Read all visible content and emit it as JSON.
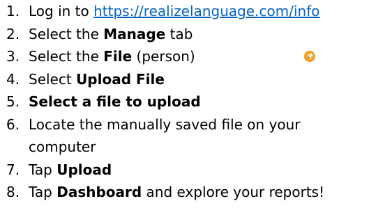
{
  "steps": [
    {
      "number": "1.",
      "prefix": "Log in to ",
      "link": "https://realizelanguage.com/info"
    },
    {
      "number": "2.",
      "prefix": "Select the ",
      "bold": "Manage",
      "suffix": " tab"
    },
    {
      "number": "3.",
      "prefix": "Select the ",
      "bold": "File",
      "suffix": " (person)",
      "icon": "orange-edit-icon"
    },
    {
      "number": "4.",
      "prefix": "Select ",
      "bold": "Upload File"
    },
    {
      "number": "5.",
      "bold": "Select a file to upload"
    },
    {
      "number": "6.",
      "text": "Locate the manually saved file on your computer"
    },
    {
      "number": "7.",
      "prefix": "Tap ",
      "bold": "Upload"
    },
    {
      "number": "8.",
      "prefix": "Tap ",
      "bold": "Dashboard",
      "suffix": " and explore your reports!"
    }
  ],
  "colors": {
    "link": "#0563c1",
    "icon_orange": "#f39a1e",
    "icon_center": "#f7c64f"
  }
}
